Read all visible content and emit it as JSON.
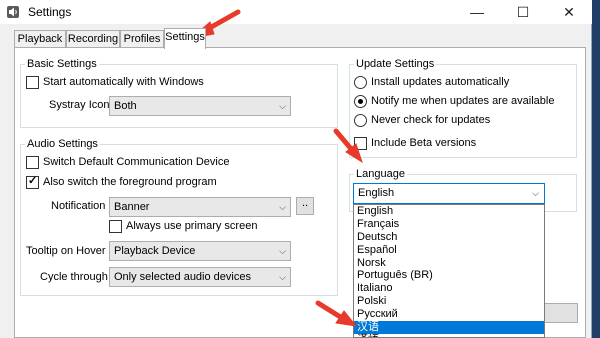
{
  "window": {
    "title": "Settings",
    "minimize": "—",
    "maximize": "☐",
    "close": "✕"
  },
  "tabs": [
    {
      "label": "Playback"
    },
    {
      "label": "Recording"
    },
    {
      "label": "Profiles"
    },
    {
      "label": "Settings",
      "active": true
    }
  ],
  "basic": {
    "title": "Basic Settings",
    "start_auto": {
      "label": "Start automatically with Windows",
      "checked": false
    },
    "systray_label": "Systray Icon",
    "systray_value": "Both"
  },
  "audio": {
    "title": "Audio Settings",
    "switch_default": {
      "label": "Switch Default Communication Device",
      "checked": false
    },
    "also_switch": {
      "label": "Also switch the foreground program",
      "checked": true
    },
    "notification_label": "Notification",
    "notification_value": "Banner",
    "more_button": "..",
    "primary_screen": {
      "label": "Always use primary screen",
      "checked": false
    },
    "tooltip_label": "Tooltip on Hover",
    "tooltip_value": "Playback Device",
    "cycle_label": "Cycle through",
    "cycle_value": "Only selected audio devices"
  },
  "update": {
    "title": "Update Settings",
    "options": [
      {
        "label": "Install updates automatically",
        "checked": false
      },
      {
        "label": "Notify me when updates are available",
        "checked": true
      },
      {
        "label": "Never check for updates",
        "checked": false
      }
    ],
    "beta": {
      "label": "Include Beta versions",
      "checked": false
    }
  },
  "language": {
    "title": "Language",
    "value": "English",
    "options": [
      "English",
      "Français",
      "Deutsch",
      "Español",
      "Norsk",
      "Português (BR)",
      "Italiano",
      "Polski",
      "Русский",
      "汉语",
      "漢語"
    ],
    "highlighted": "汉语"
  },
  "colors": {
    "accent": "#0078d7",
    "annotation_arrow": "#e83a2a"
  }
}
